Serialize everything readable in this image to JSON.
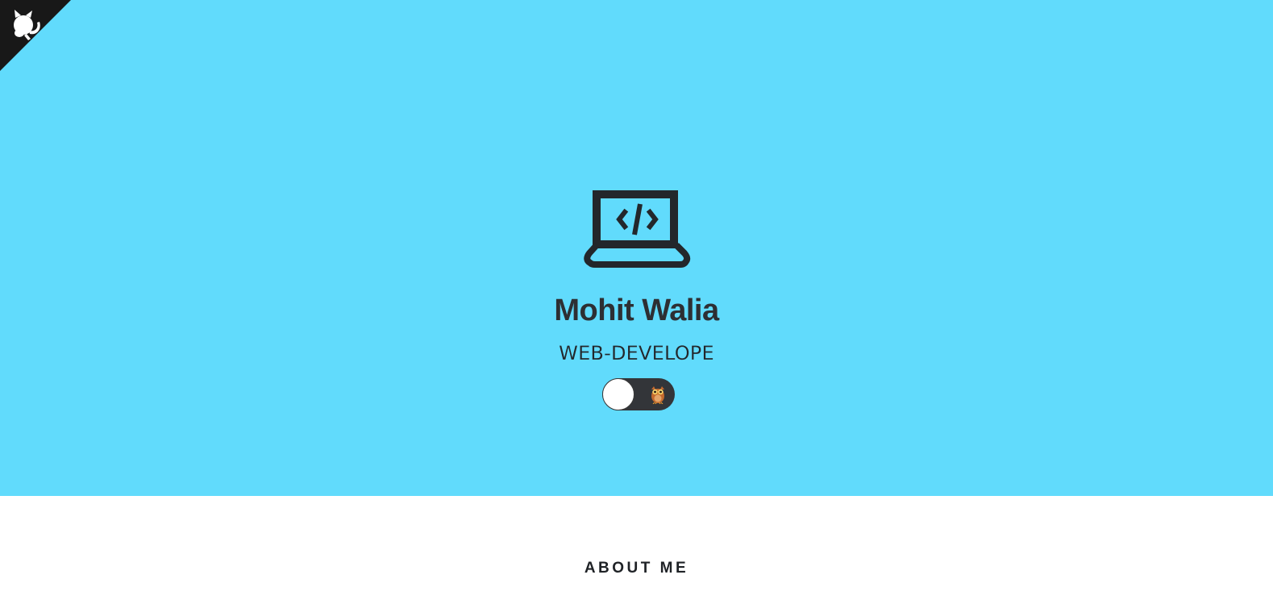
{
  "colors": {
    "hero_background": "#61dbfc",
    "text_dark": "#2d2f33",
    "toggle_track": "#333539",
    "corner": "#181818"
  },
  "corner_link": {
    "icon": "github-octocat-icon"
  },
  "hero": {
    "icon": "laptop-code-icon",
    "name": "Mohit Walia",
    "role": "WEB-DEVELOPE",
    "theme_toggle": {
      "icon": "owl-icon",
      "state": "off"
    }
  },
  "about": {
    "heading": "ABOUT ME"
  }
}
